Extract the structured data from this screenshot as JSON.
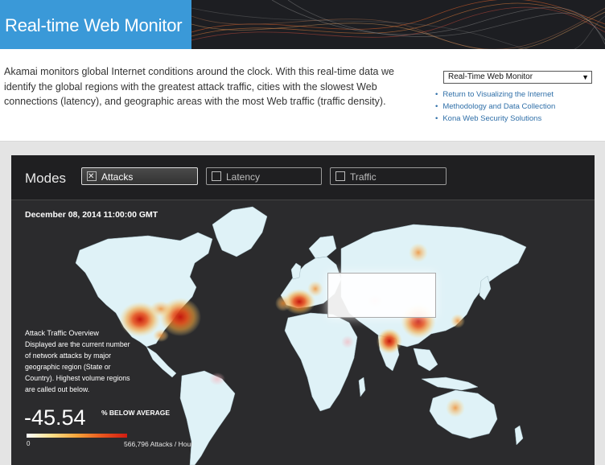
{
  "header": {
    "title": "Real-time Web Monitor",
    "accent_color": "#3a99d8"
  },
  "intro": {
    "text": "Akamai monitors global Internet conditions around the clock. With this real-time data we identify the global regions with the greatest attack traffic, cities with the slowest Web connections (latency), and geographic areas with the most Web traffic (traffic density)."
  },
  "sidebar": {
    "select_value": "Real-Time Web Monitor",
    "links": [
      {
        "label": "Return to Visualizing the Internet"
      },
      {
        "label": "Methodology and Data Collection"
      },
      {
        "label": "Kona Web Security Solutions"
      }
    ],
    "link_color": "#2f6fa8"
  },
  "modes": {
    "label": "Modes",
    "tabs": [
      {
        "label": "Attacks",
        "checked": true
      },
      {
        "label": "Latency",
        "checked": false
      },
      {
        "label": "Traffic",
        "checked": false
      }
    ]
  },
  "map": {
    "timestamp": "December 08, 2014 11:00:00 GMT",
    "overview_title": "Attack Traffic Overview",
    "overview_text": "Displayed are the current number of network attacks by major geographic region (State or Country). Highest volume regions are called out below.",
    "value": "-45.54",
    "value_caption": "% BELOW AVERAGE",
    "scale_min": "0",
    "scale_max": "566,796 Attacks / Hour",
    "land_color": "#dff2f7",
    "heat_colors": [
      "#fde08a",
      "#f5a43a",
      "#e8561e",
      "#d01c12"
    ]
  }
}
